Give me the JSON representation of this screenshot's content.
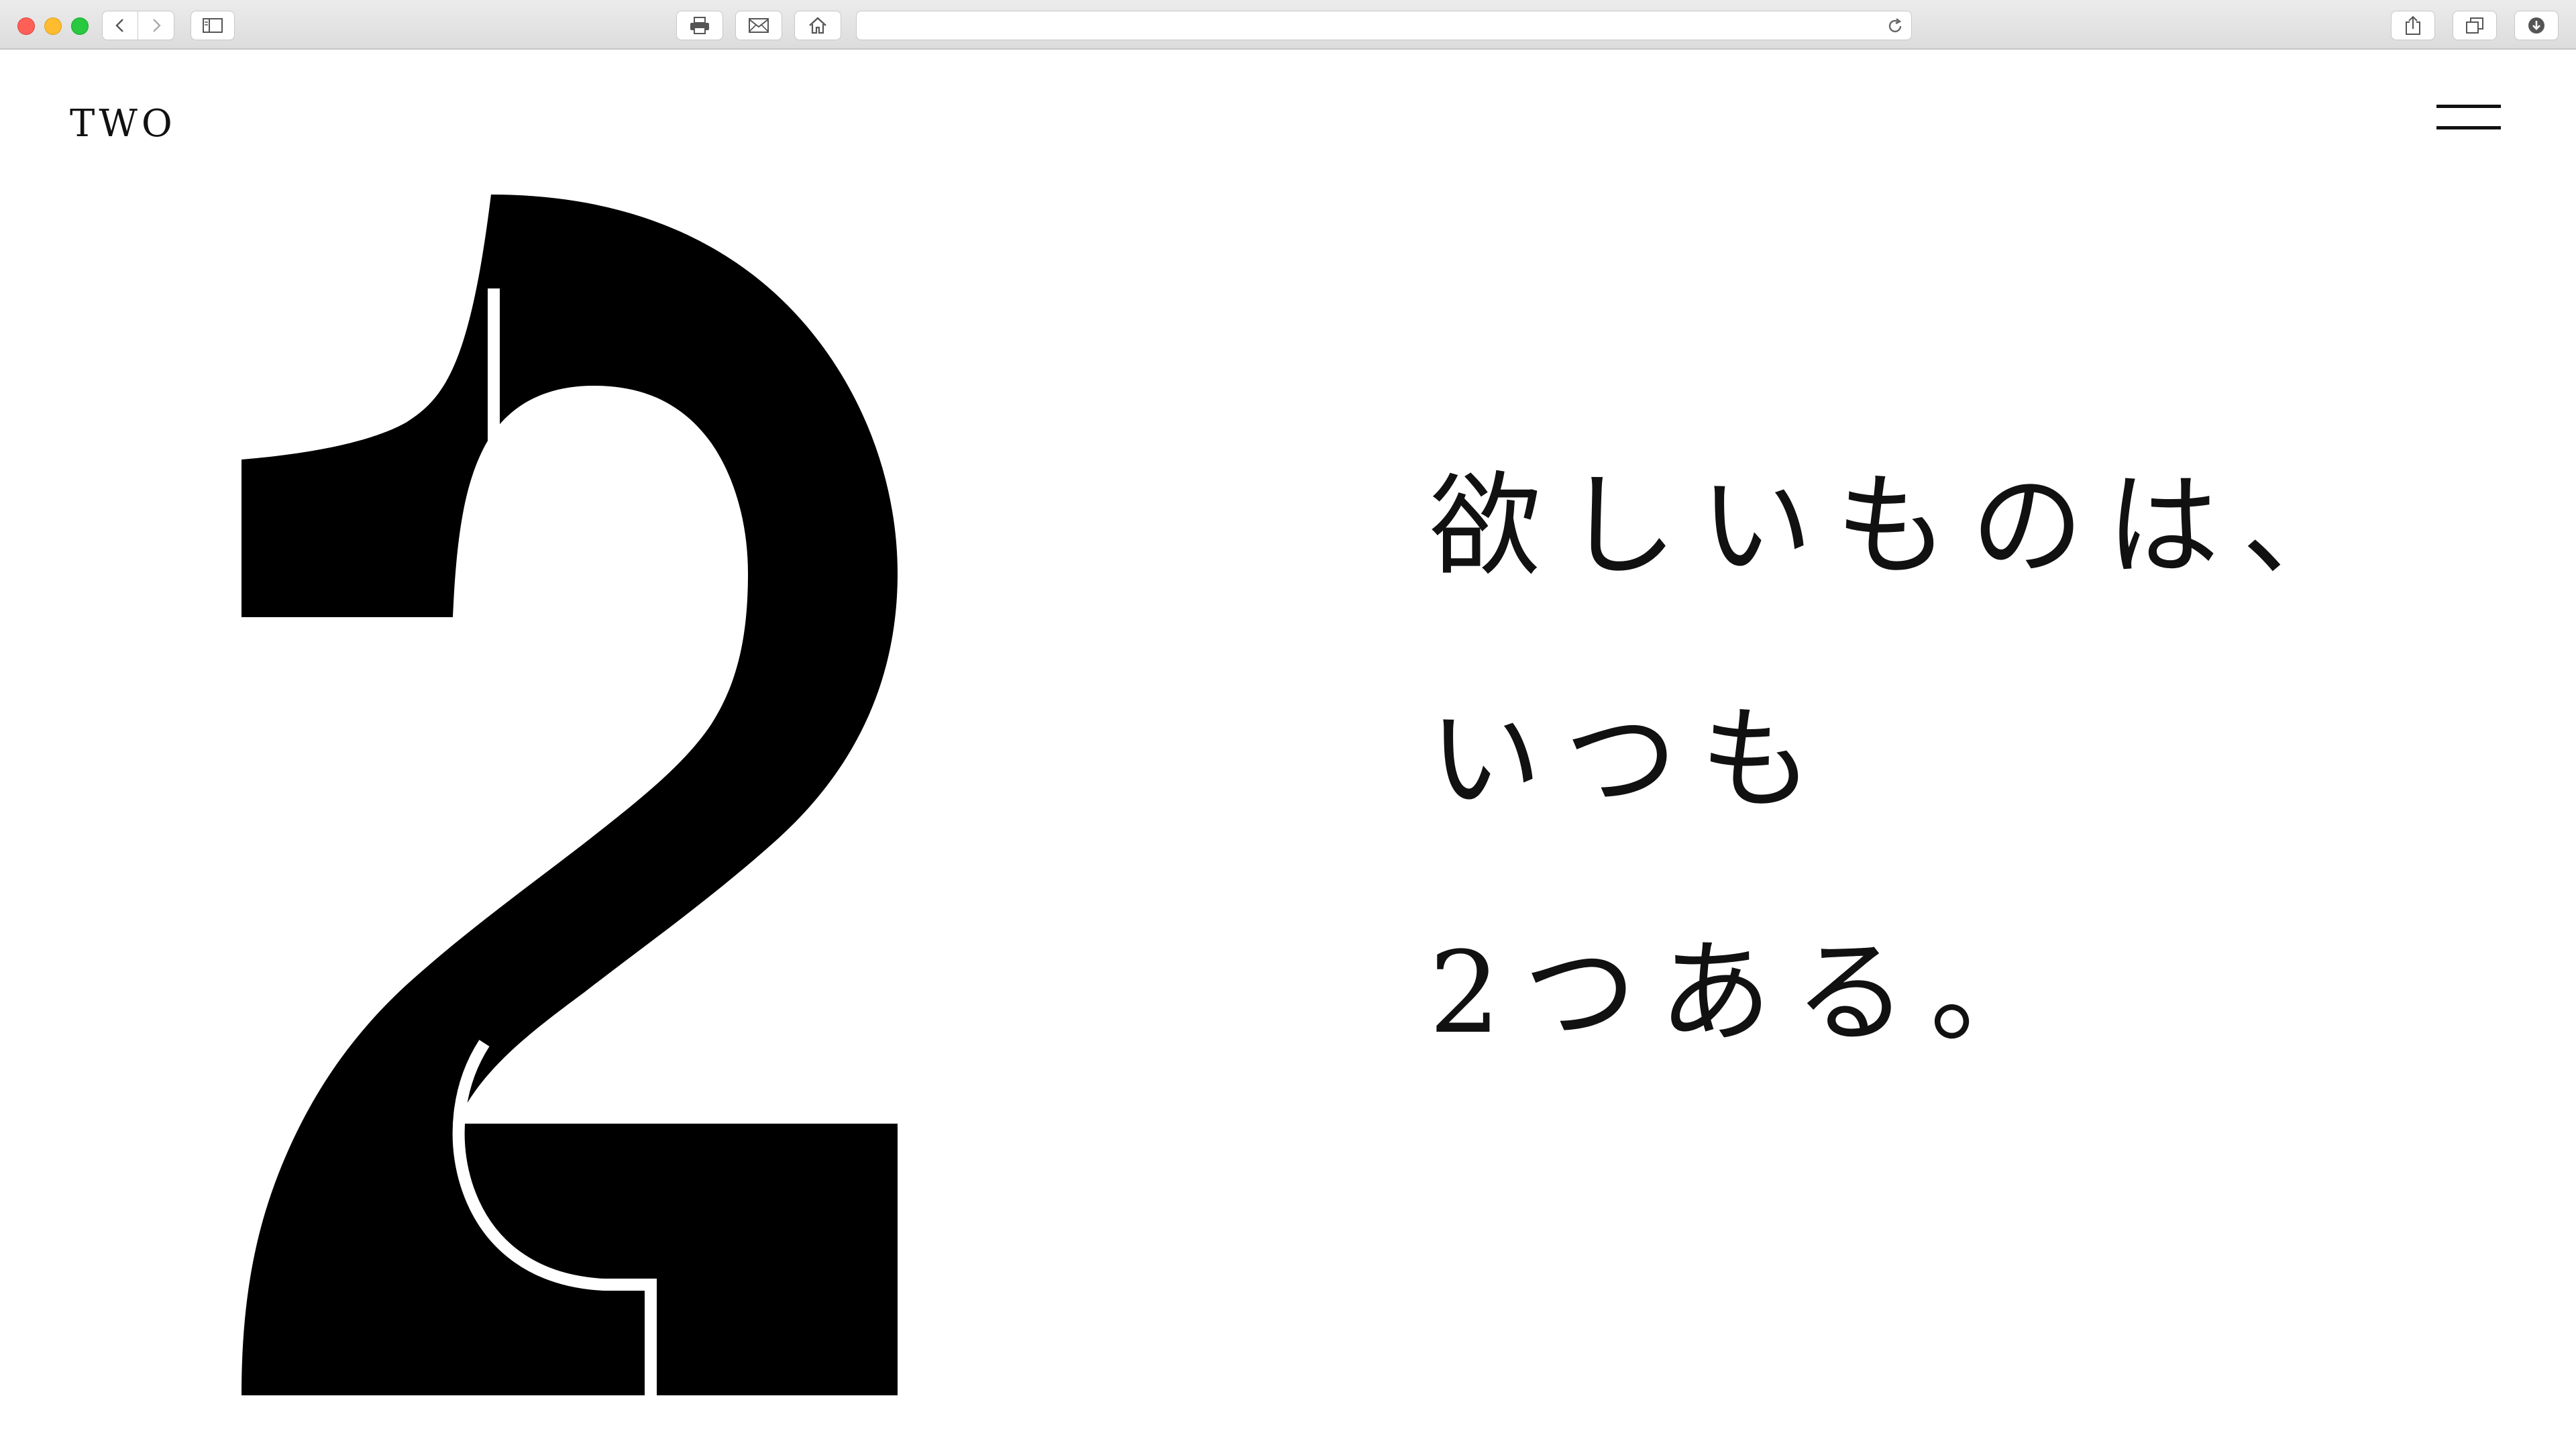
{
  "browser": {
    "url": "",
    "buttons": {
      "back": "back-icon",
      "forward": "forward-icon",
      "sidebar": "sidebar-icon",
      "print": "print-icon",
      "mail": "mail-icon",
      "home": "home-icon",
      "reload": "reload-icon",
      "share": "share-icon",
      "tabs": "tabs-icon",
      "downloads": "download-icon"
    }
  },
  "header": {
    "logo": "TWO",
    "menu_icon": "hamburger-icon"
  },
  "hero": {
    "numeral_icon": "numeral-two-graphic",
    "color": "#000000",
    "lines": [
      "欲しいものは、",
      "いつも",
      "2つある。"
    ]
  }
}
